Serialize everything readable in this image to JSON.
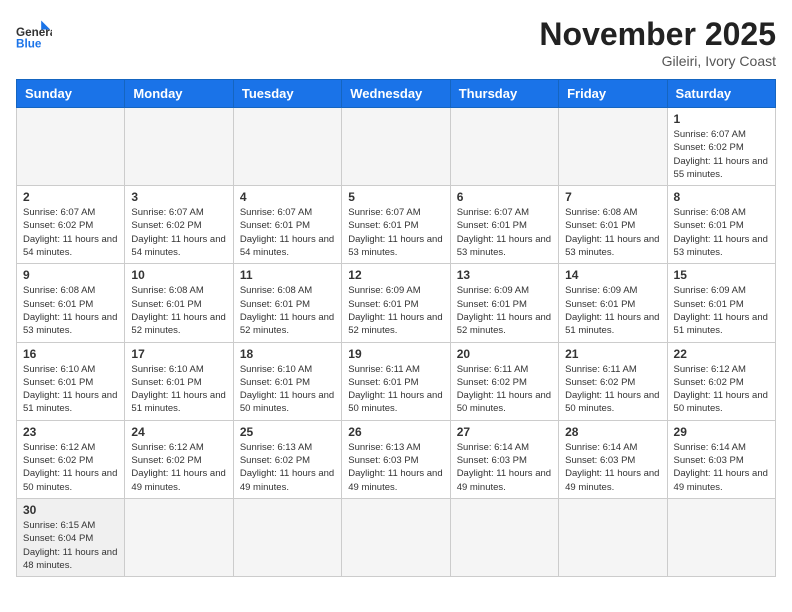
{
  "header": {
    "logo_general": "General",
    "logo_blue": "Blue",
    "month_title": "November 2025",
    "subtitle": "Gileiri, Ivory Coast"
  },
  "days_of_week": [
    "Sunday",
    "Monday",
    "Tuesday",
    "Wednesday",
    "Thursday",
    "Friday",
    "Saturday"
  ],
  "weeks": [
    [
      {
        "day": "",
        "empty": true,
        "info": ""
      },
      {
        "day": "",
        "empty": true,
        "info": ""
      },
      {
        "day": "",
        "empty": true,
        "info": ""
      },
      {
        "day": "",
        "empty": true,
        "info": ""
      },
      {
        "day": "",
        "empty": true,
        "info": ""
      },
      {
        "day": "",
        "empty": true,
        "info": ""
      },
      {
        "day": "1",
        "empty": false,
        "info": "Sunrise: 6:07 AM\nSunset: 6:02 PM\nDaylight: 11 hours\nand 55 minutes."
      }
    ],
    [
      {
        "day": "2",
        "empty": false,
        "info": "Sunrise: 6:07 AM\nSunset: 6:02 PM\nDaylight: 11 hours\nand 54 minutes."
      },
      {
        "day": "3",
        "empty": false,
        "info": "Sunrise: 6:07 AM\nSunset: 6:02 PM\nDaylight: 11 hours\nand 54 minutes."
      },
      {
        "day": "4",
        "empty": false,
        "info": "Sunrise: 6:07 AM\nSunset: 6:01 PM\nDaylight: 11 hours\nand 54 minutes."
      },
      {
        "day": "5",
        "empty": false,
        "info": "Sunrise: 6:07 AM\nSunset: 6:01 PM\nDaylight: 11 hours\nand 53 minutes."
      },
      {
        "day": "6",
        "empty": false,
        "info": "Sunrise: 6:07 AM\nSunset: 6:01 PM\nDaylight: 11 hours\nand 53 minutes."
      },
      {
        "day": "7",
        "empty": false,
        "info": "Sunrise: 6:08 AM\nSunset: 6:01 PM\nDaylight: 11 hours\nand 53 minutes."
      },
      {
        "day": "8",
        "empty": false,
        "info": "Sunrise: 6:08 AM\nSunset: 6:01 PM\nDaylight: 11 hours\nand 53 minutes."
      }
    ],
    [
      {
        "day": "9",
        "empty": false,
        "info": "Sunrise: 6:08 AM\nSunset: 6:01 PM\nDaylight: 11 hours\nand 53 minutes."
      },
      {
        "day": "10",
        "empty": false,
        "info": "Sunrise: 6:08 AM\nSunset: 6:01 PM\nDaylight: 11 hours\nand 52 minutes."
      },
      {
        "day": "11",
        "empty": false,
        "info": "Sunrise: 6:08 AM\nSunset: 6:01 PM\nDaylight: 11 hours\nand 52 minutes."
      },
      {
        "day": "12",
        "empty": false,
        "info": "Sunrise: 6:09 AM\nSunset: 6:01 PM\nDaylight: 11 hours\nand 52 minutes."
      },
      {
        "day": "13",
        "empty": false,
        "info": "Sunrise: 6:09 AM\nSunset: 6:01 PM\nDaylight: 11 hours\nand 52 minutes."
      },
      {
        "day": "14",
        "empty": false,
        "info": "Sunrise: 6:09 AM\nSunset: 6:01 PM\nDaylight: 11 hours\nand 51 minutes."
      },
      {
        "day": "15",
        "empty": false,
        "info": "Sunrise: 6:09 AM\nSunset: 6:01 PM\nDaylight: 11 hours\nand 51 minutes."
      }
    ],
    [
      {
        "day": "16",
        "empty": false,
        "info": "Sunrise: 6:10 AM\nSunset: 6:01 PM\nDaylight: 11 hours\nand 51 minutes."
      },
      {
        "day": "17",
        "empty": false,
        "info": "Sunrise: 6:10 AM\nSunset: 6:01 PM\nDaylight: 11 hours\nand 51 minutes."
      },
      {
        "day": "18",
        "empty": false,
        "info": "Sunrise: 6:10 AM\nSunset: 6:01 PM\nDaylight: 11 hours\nand 50 minutes."
      },
      {
        "day": "19",
        "empty": false,
        "info": "Sunrise: 6:11 AM\nSunset: 6:01 PM\nDaylight: 11 hours\nand 50 minutes."
      },
      {
        "day": "20",
        "empty": false,
        "info": "Sunrise: 6:11 AM\nSunset: 6:02 PM\nDaylight: 11 hours\nand 50 minutes."
      },
      {
        "day": "21",
        "empty": false,
        "info": "Sunrise: 6:11 AM\nSunset: 6:02 PM\nDaylight: 11 hours\nand 50 minutes."
      },
      {
        "day": "22",
        "empty": false,
        "info": "Sunrise: 6:12 AM\nSunset: 6:02 PM\nDaylight: 11 hours\nand 50 minutes."
      }
    ],
    [
      {
        "day": "23",
        "empty": false,
        "info": "Sunrise: 6:12 AM\nSunset: 6:02 PM\nDaylight: 11 hours\nand 50 minutes."
      },
      {
        "day": "24",
        "empty": false,
        "info": "Sunrise: 6:12 AM\nSunset: 6:02 PM\nDaylight: 11 hours\nand 49 minutes."
      },
      {
        "day": "25",
        "empty": false,
        "info": "Sunrise: 6:13 AM\nSunset: 6:02 PM\nDaylight: 11 hours\nand 49 minutes."
      },
      {
        "day": "26",
        "empty": false,
        "info": "Sunrise: 6:13 AM\nSunset: 6:03 PM\nDaylight: 11 hours\nand 49 minutes."
      },
      {
        "day": "27",
        "empty": false,
        "info": "Sunrise: 6:14 AM\nSunset: 6:03 PM\nDaylight: 11 hours\nand 49 minutes."
      },
      {
        "day": "28",
        "empty": false,
        "info": "Sunrise: 6:14 AM\nSunset: 6:03 PM\nDaylight: 11 hours\nand 49 minutes."
      },
      {
        "day": "29",
        "empty": false,
        "info": "Sunrise: 6:14 AM\nSunset: 6:03 PM\nDaylight: 11 hours\nand 49 minutes."
      }
    ],
    [
      {
        "day": "30",
        "empty": false,
        "info": "Sunrise: 6:15 AM\nSunset: 6:04 PM\nDaylight: 11 hours\nand 48 minutes."
      },
      {
        "day": "",
        "empty": true,
        "info": ""
      },
      {
        "day": "",
        "empty": true,
        "info": ""
      },
      {
        "day": "",
        "empty": true,
        "info": ""
      },
      {
        "day": "",
        "empty": true,
        "info": ""
      },
      {
        "day": "",
        "empty": true,
        "info": ""
      },
      {
        "day": "",
        "empty": true,
        "info": ""
      }
    ]
  ]
}
